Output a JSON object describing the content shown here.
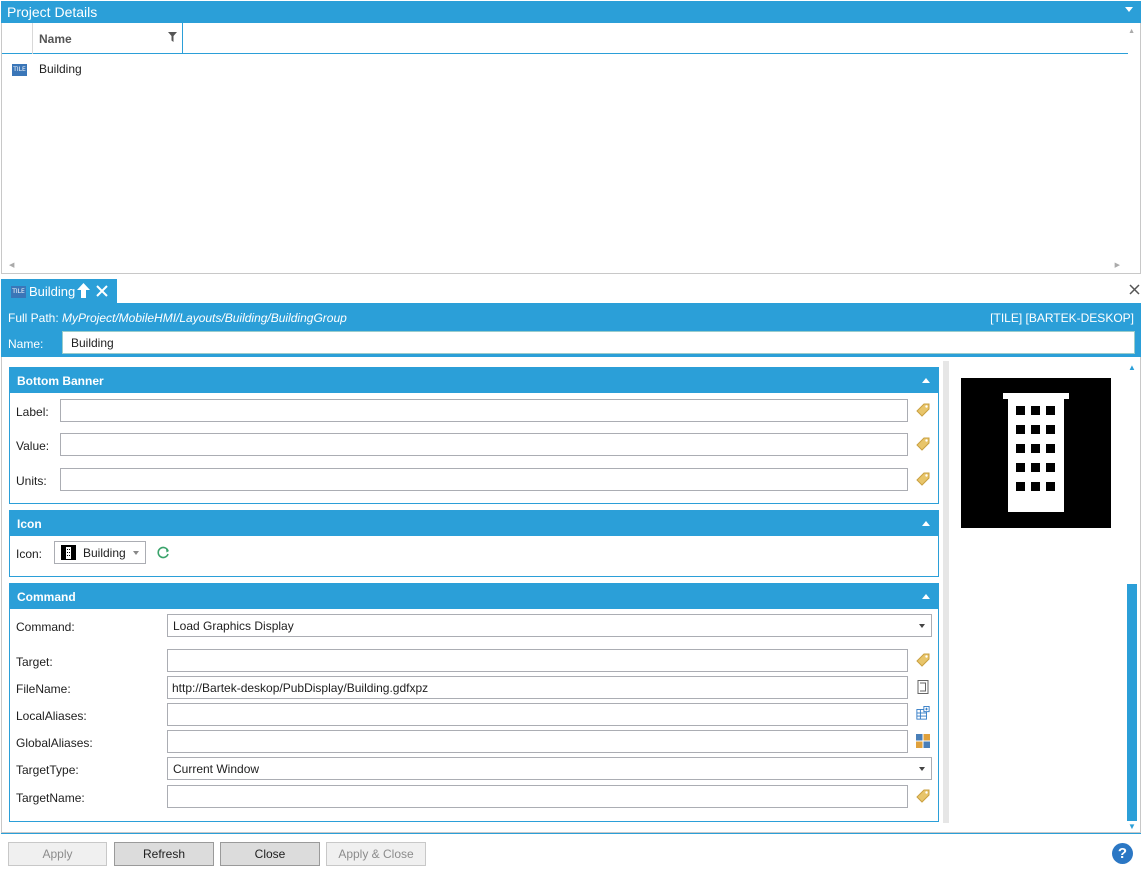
{
  "project_panel": {
    "title": "Project Details",
    "column_name": "Name",
    "rows": [
      {
        "label": "Building",
        "icon": "tile-icon"
      }
    ]
  },
  "doc_tab": {
    "label": "Building",
    "tile_text": "TILE"
  },
  "info": {
    "full_path_label": "Full Path:",
    "full_path_value": "MyProject/MobileHMI/Layouts/Building/BuildingGroup",
    "right_tag": "[TILE] [BARTEK-DESKOP]",
    "name_label": "Name:",
    "name_value": "Building"
  },
  "bottom_banner": {
    "title": "Bottom Banner",
    "label_label": "Label:",
    "value_label": "Value:",
    "units_label": "Units:",
    "label_value": "",
    "value_value": "",
    "units_value": ""
  },
  "icon_section": {
    "title": "Icon",
    "icon_label": "Icon:",
    "icon_value": "Building"
  },
  "command_section": {
    "title": "Command",
    "command_label": "Command:",
    "command_value": "Load Graphics Display",
    "target_label": "Target:",
    "target_value": "",
    "filename_label": "FileName:",
    "filename_value": "http://Bartek-deskop/PubDisplay/Building.gdfxpz",
    "local_aliases_label": "LocalAliases:",
    "local_aliases_value": "",
    "global_aliases_label": "GlobalAliases:",
    "global_aliases_value": "",
    "target_type_label": "TargetType:",
    "target_type_value": "Current Window",
    "target_name_label": "TargetName:",
    "target_name_value": ""
  },
  "buttons": {
    "apply": "Apply",
    "refresh": "Refresh",
    "close": "Close",
    "apply_close": "Apply & Close",
    "help": "?"
  },
  "colors": {
    "accent": "#2b9fd8",
    "tile_icon": "#3a76b8"
  }
}
